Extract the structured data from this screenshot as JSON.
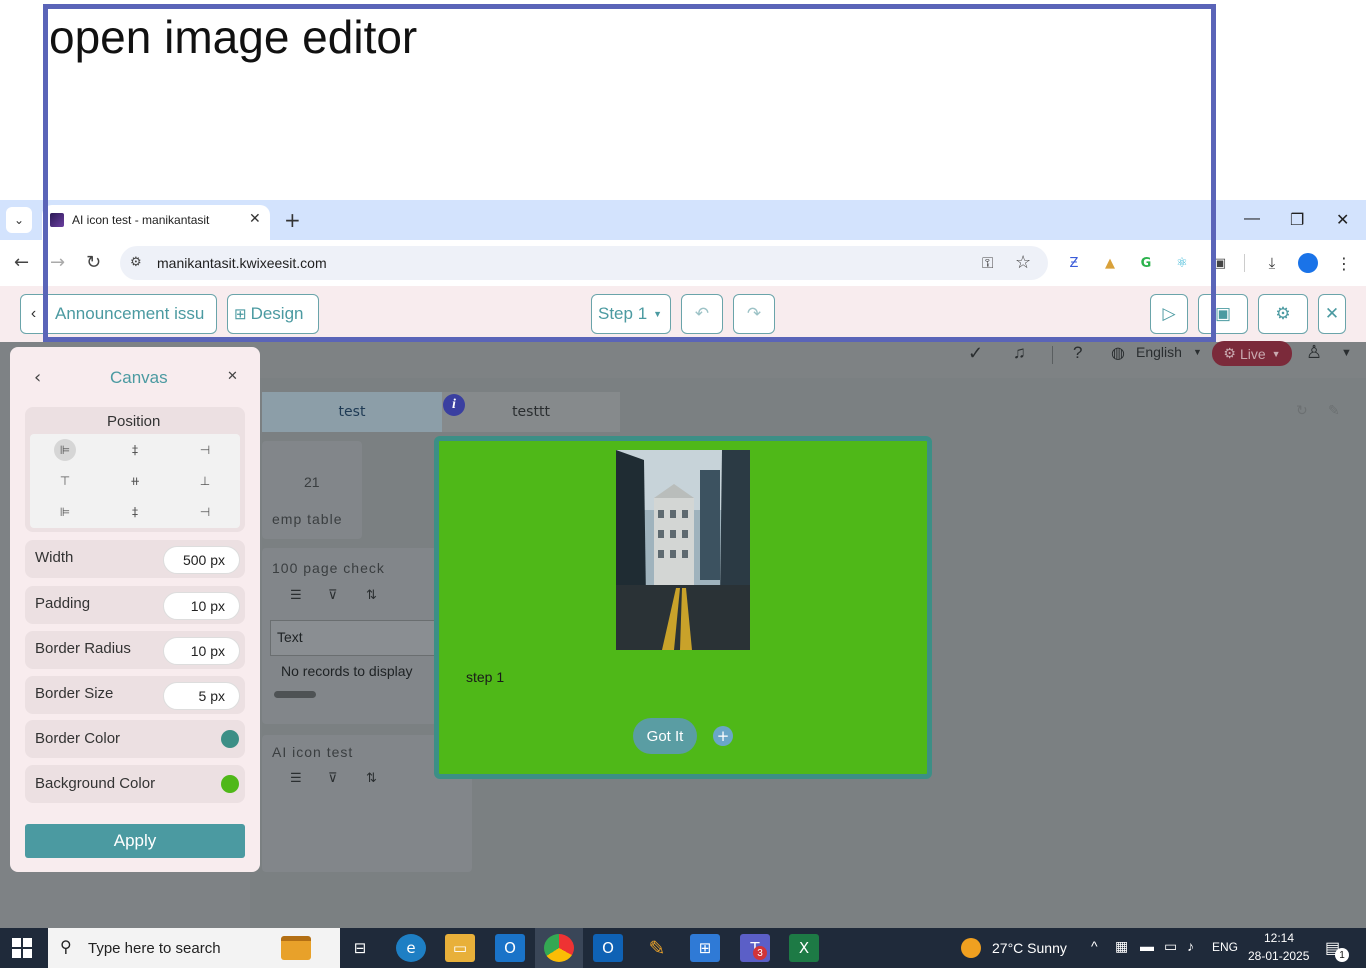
{
  "caption": "open image editor",
  "browser": {
    "tab_title": "AI icon test - manikantasit",
    "url": "manikantasit.kwixeesit.com",
    "tab_close": "✕",
    "new_tab": "+",
    "minimize": "—",
    "restore": "❐",
    "close": "✕"
  },
  "app_header": {
    "back_label": "Announcement issu",
    "design_label": "Design",
    "step_select": "Step 1"
  },
  "topbar": {
    "language": "English",
    "live": "Live"
  },
  "tabs": {
    "test": "test",
    "testtt": "testtt"
  },
  "cards": {
    "emp_count": "21",
    "emp_label": "emp table",
    "page_check": "100 page check",
    "text_col": "Text",
    "no_records": "No records to display",
    "ai_icon_test": "AI icon test"
  },
  "panel": {
    "title": "Canvas",
    "position_label": "Position",
    "width_label": "Width",
    "width_value": "500 px",
    "padding_label": "Padding",
    "padding_value": "10 px",
    "radius_label": "Border Radius",
    "radius_value": "10 px",
    "border_size_label": "Border Size",
    "border_size_value": "5 px",
    "border_color_label": "Border Color",
    "border_color": "#3c8f86",
    "bg_color_label": "Background Color",
    "bg_color": "#4fb818",
    "apply_label": "Apply"
  },
  "popup": {
    "step_text": "step 1",
    "got_it": "Got It",
    "plus": "+",
    "info": "i"
  },
  "taskbar": {
    "search_placeholder": "Type here to search",
    "weather": "27°C  Sunny",
    "lang": "ENG",
    "time": "12:14",
    "date": "28-01-2025",
    "teams_badge": "3",
    "notif_badge": "1"
  }
}
